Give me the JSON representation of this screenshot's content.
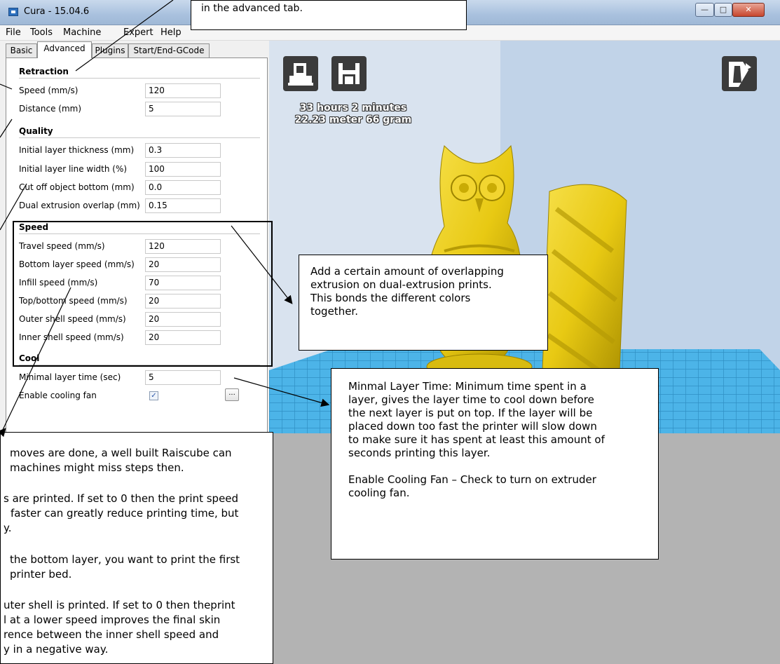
{
  "window": {
    "title": "Cura - 15.04.6",
    "controls": [
      "minimize",
      "maximize",
      "close"
    ]
  },
  "menu": [
    "File",
    "Tools",
    "Machine",
    "Expert",
    "Help"
  ],
  "tabs": [
    {
      "label": "Basic",
      "active": false
    },
    {
      "label": "Advanced",
      "active": true
    },
    {
      "label": "Plugins",
      "active": false
    },
    {
      "label": "Start/End-GCode",
      "active": false
    }
  ],
  "settings": {
    "retraction": {
      "title": "Retraction",
      "rows": [
        {
          "label": "Speed (mm/s)",
          "value": "120"
        },
        {
          "label": "Distance (mm)",
          "value": "5"
        }
      ]
    },
    "quality": {
      "title": "Quality",
      "rows": [
        {
          "label": "Initial layer thickness (mm)",
          "value": "0.3"
        },
        {
          "label": "Initial layer line width (%)",
          "value": "100"
        },
        {
          "label": "Cut off object bottom (mm)",
          "value": "0.0"
        },
        {
          "label": "Dual extrusion overlap (mm)",
          "value": "0.15"
        }
      ]
    },
    "speed": {
      "title": "Speed",
      "rows": [
        {
          "label": "Travel speed (mm/s)",
          "value": "120"
        },
        {
          "label": "Bottom layer speed (mm/s)",
          "value": "20"
        },
        {
          "label": "Infill speed (mm/s)",
          "value": "70"
        },
        {
          "label": "Top/bottom speed (mm/s)",
          "value": "20"
        },
        {
          "label": "Outer shell speed (mm/s)",
          "value": "20"
        },
        {
          "label": "Inner shell speed (mm/s)",
          "value": "20"
        }
      ]
    },
    "cool": {
      "title": "Cool",
      "rows": [
        {
          "label": "Minimal layer time (sec)",
          "value": "5"
        },
        {
          "label": "Enable cooling fan",
          "checked": true,
          "button": "..."
        }
      ]
    }
  },
  "viewport": {
    "print_time": "33 hours 2 minutes",
    "print_material": "22.23 meter 66 gram",
    "buttons": [
      "print-button",
      "save-button",
      "view-mode-button"
    ]
  },
  "callouts": {
    "top": "in the advanced tab.",
    "overlap": [
      "Add a certain amount of overlapping",
      "extrusion on dual-extrusion prints.",
      "This bonds the different colors",
      "together."
    ],
    "minlayer": [
      "Minmal Layer Time: Minimum time spent in a",
      "layer, gives the layer time to cool down before",
      "the next layer is put on top. If the layer will be",
      "placed down too fast the printer will slow down",
      "to make sure it has spent at least this amount of",
      "seconds printing this layer.",
      "",
      "Enable Cooling Fan – Check to turn on extruder",
      "cooling fan."
    ],
    "bottom": [
      "moves are done, a well built Raiscube can",
      "machines might miss steps then.",
      "",
      "s are printed. If set to 0 then the print speed",
      "faster can greatly reduce printing time, but",
      "y.",
      "",
      "the bottom layer, you want to print the first",
      "printer bed.",
      "",
      "uter shell is printed. If set to 0 then theprint",
      "l at a lower speed improves the final skin",
      "rence between the inner shell speed and",
      "y in a negative way."
    ]
  }
}
